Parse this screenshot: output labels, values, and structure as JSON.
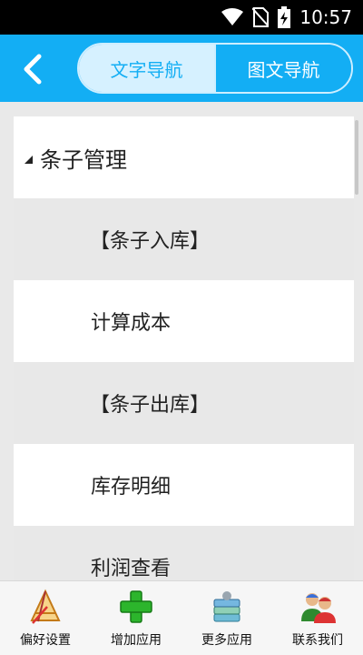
{
  "status_bar": {
    "time": "10:57",
    "icons": [
      "wifi-icon",
      "no-sim-icon",
      "battery-charging-icon"
    ]
  },
  "header": {
    "back_icon": "back-arrow-icon",
    "tabs": [
      {
        "label": "文字导航",
        "active": true
      },
      {
        "label": "图文导航",
        "active": false
      }
    ]
  },
  "nav": {
    "group_title": "条子管理",
    "items": [
      {
        "label": "【条子入库】"
      },
      {
        "label": "计算成本"
      },
      {
        "label": "【条子出库】"
      },
      {
        "label": "库存明细"
      },
      {
        "label": "利润查看"
      }
    ]
  },
  "toolbar": {
    "items": [
      {
        "label": "偏好设置",
        "icon": "preferences-icon"
      },
      {
        "label": "增加应用",
        "icon": "add-app-icon"
      },
      {
        "label": "更多应用",
        "icon": "more-apps-icon"
      },
      {
        "label": "联系我们",
        "icon": "contact-us-icon"
      }
    ]
  },
  "colors": {
    "header": "#13aef4",
    "tab_active_bg": "#d6f1ff",
    "row_grey": "#e8e8e8"
  }
}
